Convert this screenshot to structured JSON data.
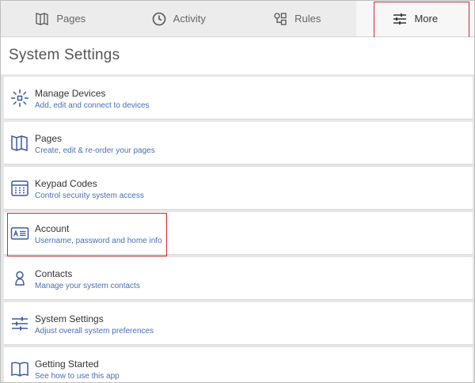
{
  "tabs": [
    {
      "label": "Pages",
      "icon": "pages-icon"
    },
    {
      "label": "Activity",
      "icon": "clock-icon"
    },
    {
      "label": "Rules",
      "icon": "rules-icon"
    },
    {
      "label": "More",
      "icon": "sliders-icon"
    }
  ],
  "header": {
    "title": "System Settings"
  },
  "items": [
    {
      "title": "Manage Devices",
      "subtitle": "Add, edit and connect to devices",
      "icon": "devices-icon"
    },
    {
      "title": "Pages",
      "subtitle": "Create, edit & re-order your pages",
      "icon": "pages-icon"
    },
    {
      "title": "Keypad Codes",
      "subtitle": "Control security system access",
      "icon": "keypad-icon"
    },
    {
      "title": "Account",
      "subtitle": "Username, password and home info",
      "icon": "account-card-icon"
    },
    {
      "title": "Contacts",
      "subtitle": "Manage your system contacts",
      "icon": "contacts-icon"
    },
    {
      "title": "System Settings",
      "subtitle": "Adjust overall system preferences",
      "icon": "sliders-icon"
    },
    {
      "title": "Getting Started",
      "subtitle": "See how to use this app",
      "icon": "book-icon"
    }
  ],
  "colors": {
    "accent": "#4a6fb4",
    "highlight": "#d9232e",
    "tabbar_bg": "#ececec"
  }
}
